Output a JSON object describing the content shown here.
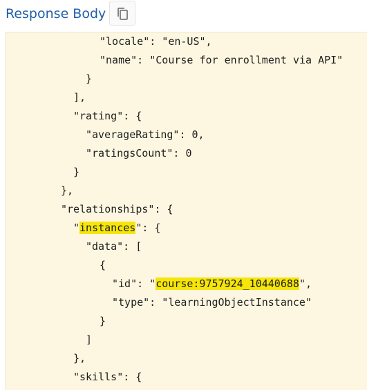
{
  "header": {
    "title": "Response Body",
    "copy_icon": "copy-icon"
  },
  "colors": {
    "title": "#1f5fa8",
    "panel_bg": "#fdf7e1",
    "highlight": "#f5e50b",
    "code_text": "#1e1e1e"
  },
  "code_lines": [
    {
      "pre": "\"locale\": \"en-US\",",
      "hl": "",
      "post": ""
    },
    {
      "pre": "\"name\": \"Course for enrollment via API\"",
      "hl": "",
      "post": ""
    },
    {
      "pre": "}",
      "hl": "",
      "post": ""
    },
    {
      "pre": "],",
      "hl": "",
      "post": ""
    },
    {
      "pre": "\"rating\": {",
      "hl": "",
      "post": ""
    },
    {
      "pre": "\"averageRating\": 0,",
      "hl": "",
      "post": ""
    },
    {
      "pre": "\"ratingsCount\": 0",
      "hl": "",
      "post": ""
    },
    {
      "pre": "}",
      "hl": "",
      "post": ""
    },
    {
      "pre": "},",
      "hl": "",
      "post": ""
    },
    {
      "pre": "\"relationships\": {",
      "hl": "",
      "post": ""
    },
    {
      "pre": "\"",
      "hl": "instances",
      "post": "\": {"
    },
    {
      "pre": "\"data\": [",
      "hl": "",
      "post": ""
    },
    {
      "pre": "{",
      "hl": "",
      "post": ""
    },
    {
      "pre": "\"id\": \"",
      "hl": "course:9757924_10440688",
      "post": "\","
    },
    {
      "pre": "\"type\": \"learningObjectInstance\"",
      "hl": "",
      "post": ""
    },
    {
      "pre": "}",
      "hl": "",
      "post": ""
    },
    {
      "pre": "]",
      "hl": "",
      "post": ""
    },
    {
      "pre": "},",
      "hl": "",
      "post": ""
    },
    {
      "pre": "\"skills\": {",
      "hl": "",
      "post": ""
    }
  ]
}
